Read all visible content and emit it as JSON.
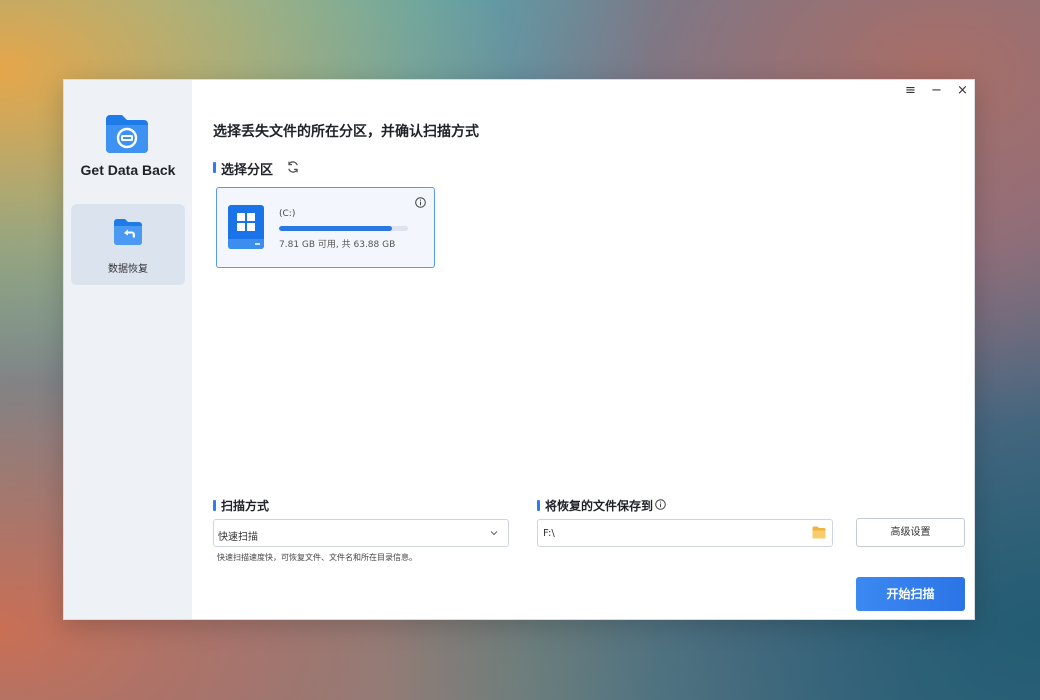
{
  "app": {
    "name": "Get Data Back"
  },
  "sidebar": {
    "items": [
      {
        "label": "数据恢复",
        "active": true
      }
    ]
  },
  "window_controls": {
    "menu": "≡",
    "minimize": "−",
    "close": "×"
  },
  "main": {
    "title": "选择丢失文件的所在分区，并确认扫描方式",
    "partition_section": {
      "title": "选择分区",
      "drives": [
        {
          "name": "(C:)",
          "space_text": "7.81 GB 可用, 共 63.88 GB",
          "used_fraction": 0.878,
          "selected": true
        }
      ]
    },
    "scan_mode": {
      "title": "扫描方式",
      "selected": "快速扫描",
      "hint": "快速扫描速度快，可恢复文件、文件名和所在目录信息。"
    },
    "save_to": {
      "title": "将恢复的文件保存到",
      "path": "F:\\"
    },
    "advanced_button": "高级设置",
    "start_button": "开始扫描"
  },
  "colors": {
    "accent": "#2f7bf0",
    "sidebar_bg": "#eef1f6",
    "active_item_bg": "#dbe3ef"
  }
}
